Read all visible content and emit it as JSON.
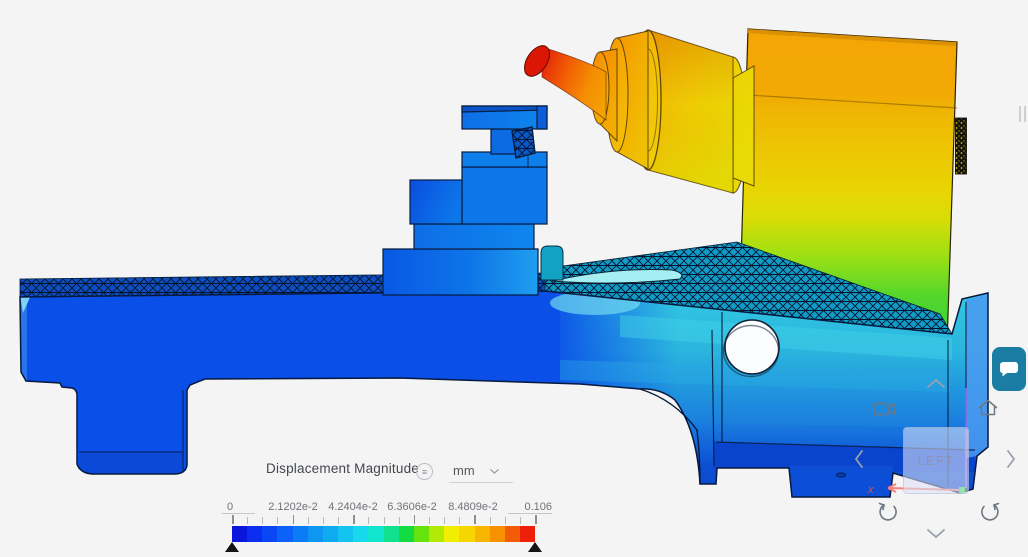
{
  "legend": {
    "title": "Displacement Magnitude",
    "unit": "mm",
    "tick_labels": [
      "0",
      "2.1202e-2",
      "4.2404e-2",
      "6.3606e-2",
      "8.4809e-2",
      "0.106"
    ],
    "range_min": "0",
    "range_max": "0.106",
    "colors": [
      "#0b16dd",
      "#0b2ef0",
      "#0947f5",
      "#0b61f8",
      "#0b7cf5",
      "#0d97f2",
      "#0fabf0",
      "#13c3f0",
      "#17d9ee",
      "#12e6cf",
      "#0fe18e",
      "#12dc41",
      "#66e30c",
      "#b2ea05",
      "#f2ee02",
      "#f6d501",
      "#f8b501",
      "#f79100",
      "#f25c06",
      "#ee2008"
    ]
  },
  "view_cube": {
    "face_label": "LEFT"
  },
  "axes": {
    "x_label": "x"
  },
  "ui": {
    "chat_button_color": "#1b7ca4",
    "background": "#f5f4f4"
  }
}
